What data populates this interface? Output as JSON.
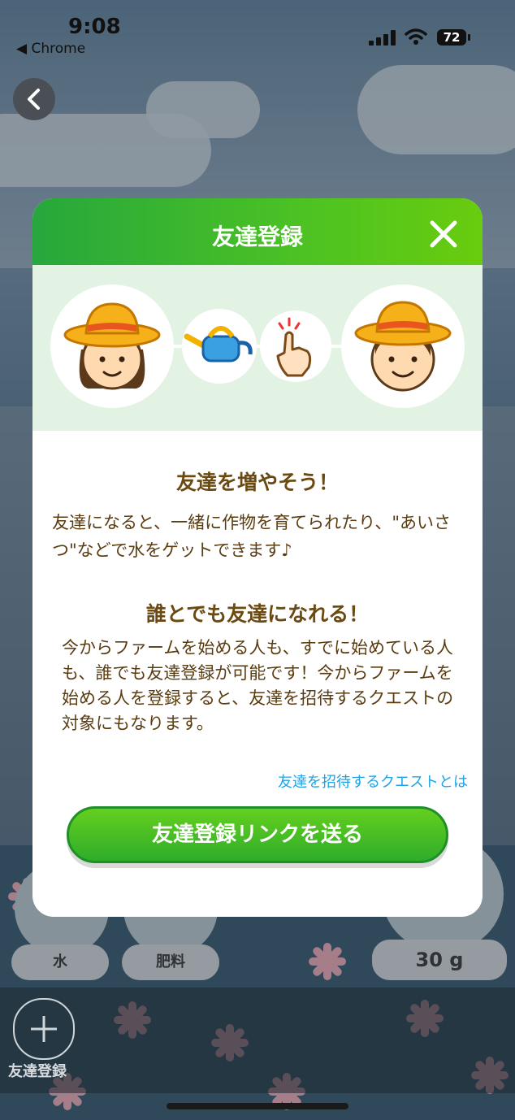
{
  "status_bar": {
    "time": "9:08",
    "back_to_app": "◀ Chrome",
    "battery": "72"
  },
  "game_ui": {
    "water_label": "水",
    "fertilizer_label": "肥料",
    "grams_label": "30 g",
    "add_friend_label": "友達登録"
  },
  "modal": {
    "title": "友達登録",
    "heading1": "友達を増やそう！",
    "para1": "友達になると、一緒に作物を育てられたり、\"あいさつ\"などで水をゲットできます♪",
    "heading2": "誰とでも友達になれる！",
    "para2": "今からファームを始める人も、すでに始めている人も、誰でも友達登録が可能です！今からファームを始める人を登録すると、友達を招待するクエストの対象にもなります。",
    "quest_link": "友達を招待するクエストとは",
    "send_button": "友達登録リンクを送る"
  },
  "colors": {
    "header_green": "#3bb42f",
    "link_blue": "#1ea3e6",
    "text_brown": "#5a3c10"
  },
  "icons": [
    "back-chevron-icon",
    "close-icon",
    "farmer-girl-icon",
    "watering-can-icon",
    "tap-hand-icon",
    "farmer-boy-icon",
    "plus-icon"
  ]
}
